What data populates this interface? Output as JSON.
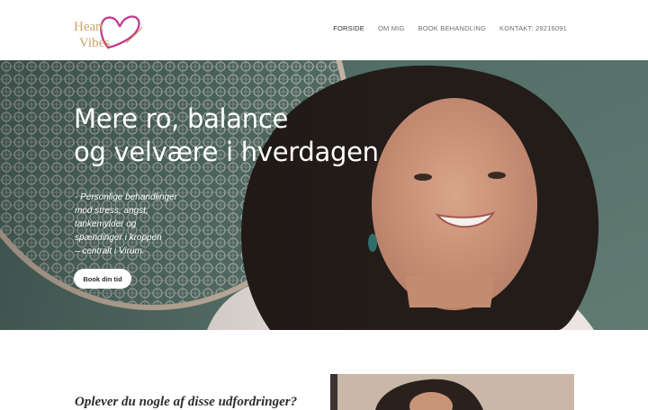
{
  "logo": {
    "line1": "Heart",
    "line2": "Vibes"
  },
  "nav": {
    "items": [
      {
        "label": "FORSIDE"
      },
      {
        "label": "OM MIG"
      },
      {
        "label": "BOOK BEHANDLING"
      },
      {
        "label": "KONTAKT: 29216091"
      }
    ],
    "active_index": 0
  },
  "hero": {
    "title_lines": [
      "Mere ro, balance",
      "og velvære i hverdagen"
    ],
    "subtitle_lines": [
      "- Personlige behandlinger",
      "mod stress, angst,",
      "tankemylder og",
      "spændinger i kroppen",
      "– centralt i Virum."
    ],
    "button_label": "Book din tid"
  },
  "section": {
    "heading": "Oplever du nogle af disse udfordringer?"
  },
  "colors": {
    "brand_pink": "#c2358f",
    "brand_gold": "#c9a46a",
    "hero_green": "#556f67",
    "text_dark": "#2d2d2d"
  }
}
